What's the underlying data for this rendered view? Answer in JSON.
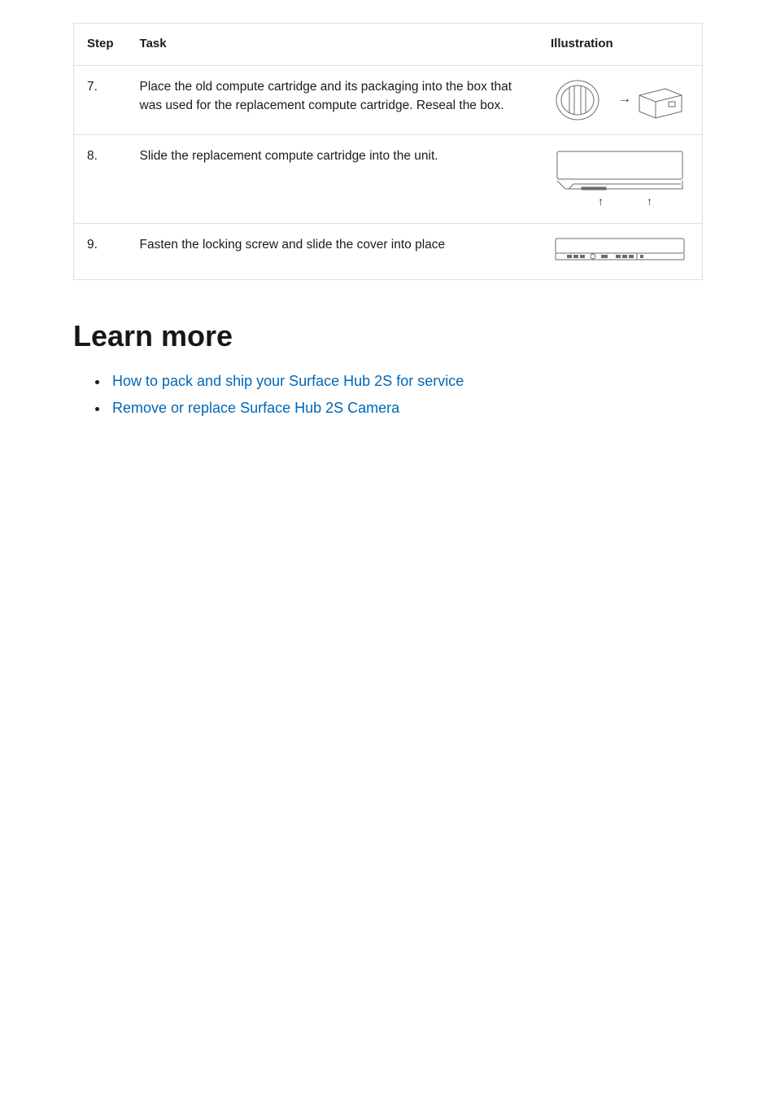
{
  "table": {
    "headers": {
      "step": "Step",
      "task": "Task",
      "illustration": "Illustration"
    },
    "rows": [
      {
        "step": "7.",
        "task": "Place the old compute cartridge and its packaging into the box that was used for the replacement compute cartridge. Reseal the box."
      },
      {
        "step": "8.",
        "task": "Slide the replacement compute cartridge into the unit."
      },
      {
        "step": "9.",
        "task": "Fasten the locking screw and slide the cover into place"
      }
    ]
  },
  "learn_more": {
    "heading": "Learn more",
    "links": [
      "How to pack and ship your Surface Hub 2S for service",
      "Remove or replace Surface Hub 2S Camera"
    ]
  }
}
